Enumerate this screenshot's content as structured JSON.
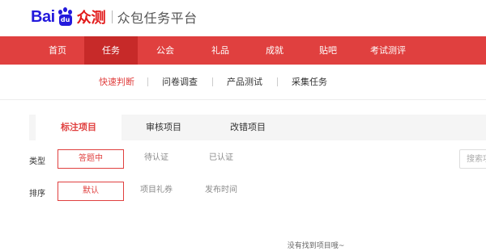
{
  "header": {
    "logo_bai": "Bai",
    "logo_du": "du",
    "logo_brand": "众测",
    "subtitle": "众包任务平台"
  },
  "main_nav": {
    "items": [
      {
        "label": "首页"
      },
      {
        "label": "任务",
        "active": true
      },
      {
        "label": "公会"
      },
      {
        "label": "礼品"
      },
      {
        "label": "成就"
      },
      {
        "label": "贴吧"
      },
      {
        "label": "考试测评"
      }
    ]
  },
  "sub_nav": {
    "items": [
      {
        "label": "快速判断",
        "active": true
      },
      {
        "label": "问卷调查"
      },
      {
        "label": "产品测试"
      },
      {
        "label": "采集任务"
      }
    ]
  },
  "tabs": [
    {
      "label": "标注项目",
      "active": true
    },
    {
      "label": "审核项目"
    },
    {
      "label": "改错项目"
    }
  ],
  "filters": {
    "type_label": "类型",
    "type_options": [
      {
        "label": "答题中",
        "selected": true
      },
      {
        "label": "待认证"
      },
      {
        "label": "已认证"
      }
    ],
    "sort_label": "排序",
    "sort_options": [
      {
        "label": "默认",
        "selected": true
      },
      {
        "label": "项目礼券"
      },
      {
        "label": "发布时间"
      }
    ]
  },
  "search": {
    "placeholder": "搜索项"
  },
  "empty_message": "没有找到项目哦~",
  "colors": {
    "nav_bg": "#e0403f",
    "nav_active": "#c72a29",
    "accent": "#e0403f",
    "baidu_blue": "#2319dc"
  }
}
